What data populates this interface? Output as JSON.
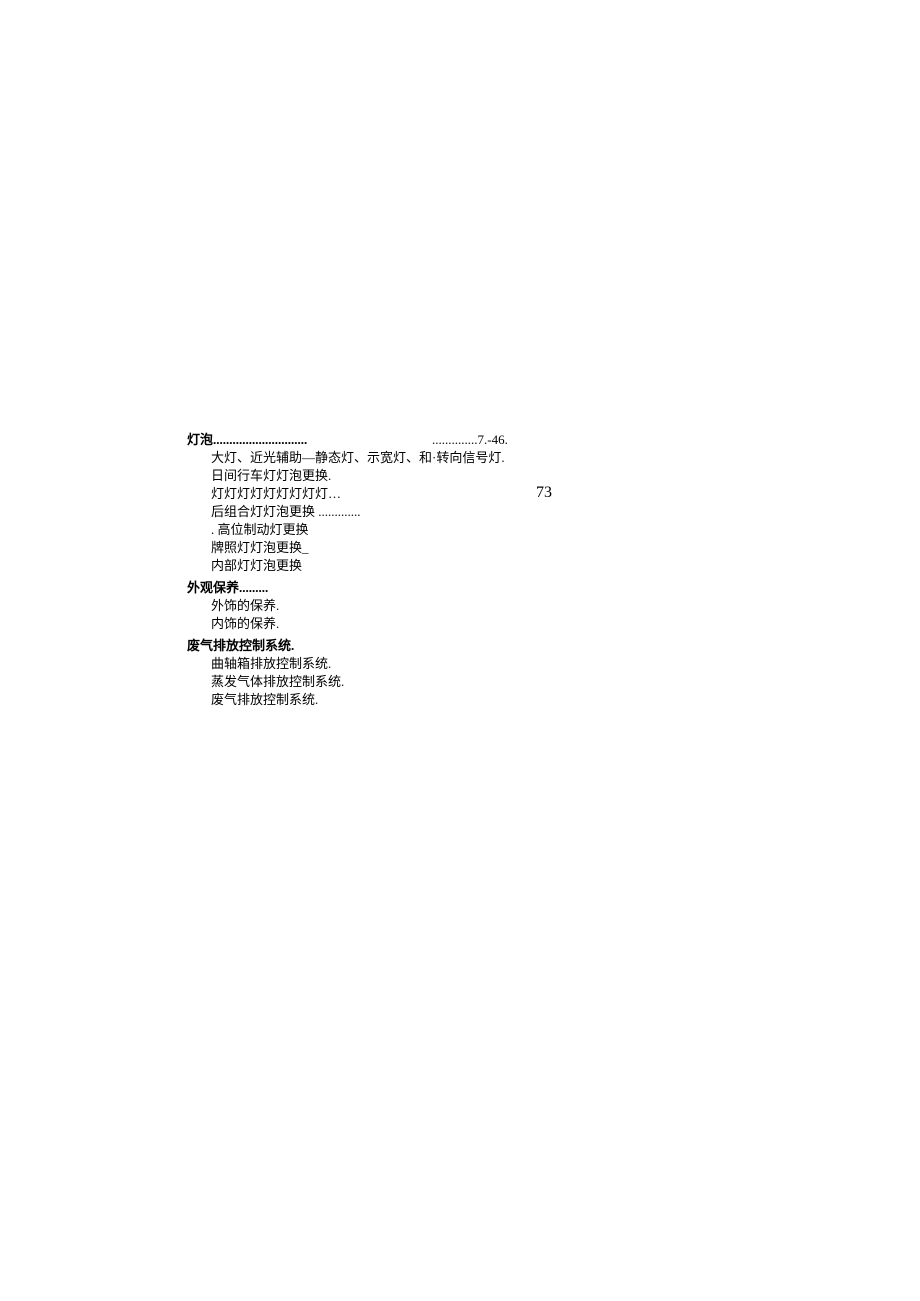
{
  "columnLeft": {
    "section1": {
      "heading": "灯泡.............................",
      "items": [
        "大灯、近光辅助—静态灯、示宽灯、和日间行车灯灯泡更换.",
        "灯灯灯灯灯灯灯灯灯…",
        "后组合灯灯泡更换 .............",
        ". 高位制动灯更换",
        "牌照灯灯泡更换_",
        "内部灯灯泡更换"
      ]
    },
    "section2": {
      "heading": "外观保养.........",
      "items": [
        "外饰的保养.",
        "内饰的保养."
      ]
    },
    "section3": {
      "heading": "废气排放控制系统.",
      "items": [
        "曲轴箱排放控制系统.",
        "蒸发气体排放控制系统.",
        "废气排放控制系统."
      ]
    }
  },
  "columnRight": {
    "pageRef": "..............7.-46.",
    "item": "·转向信号灯.",
    "pageNumber": "73"
  }
}
